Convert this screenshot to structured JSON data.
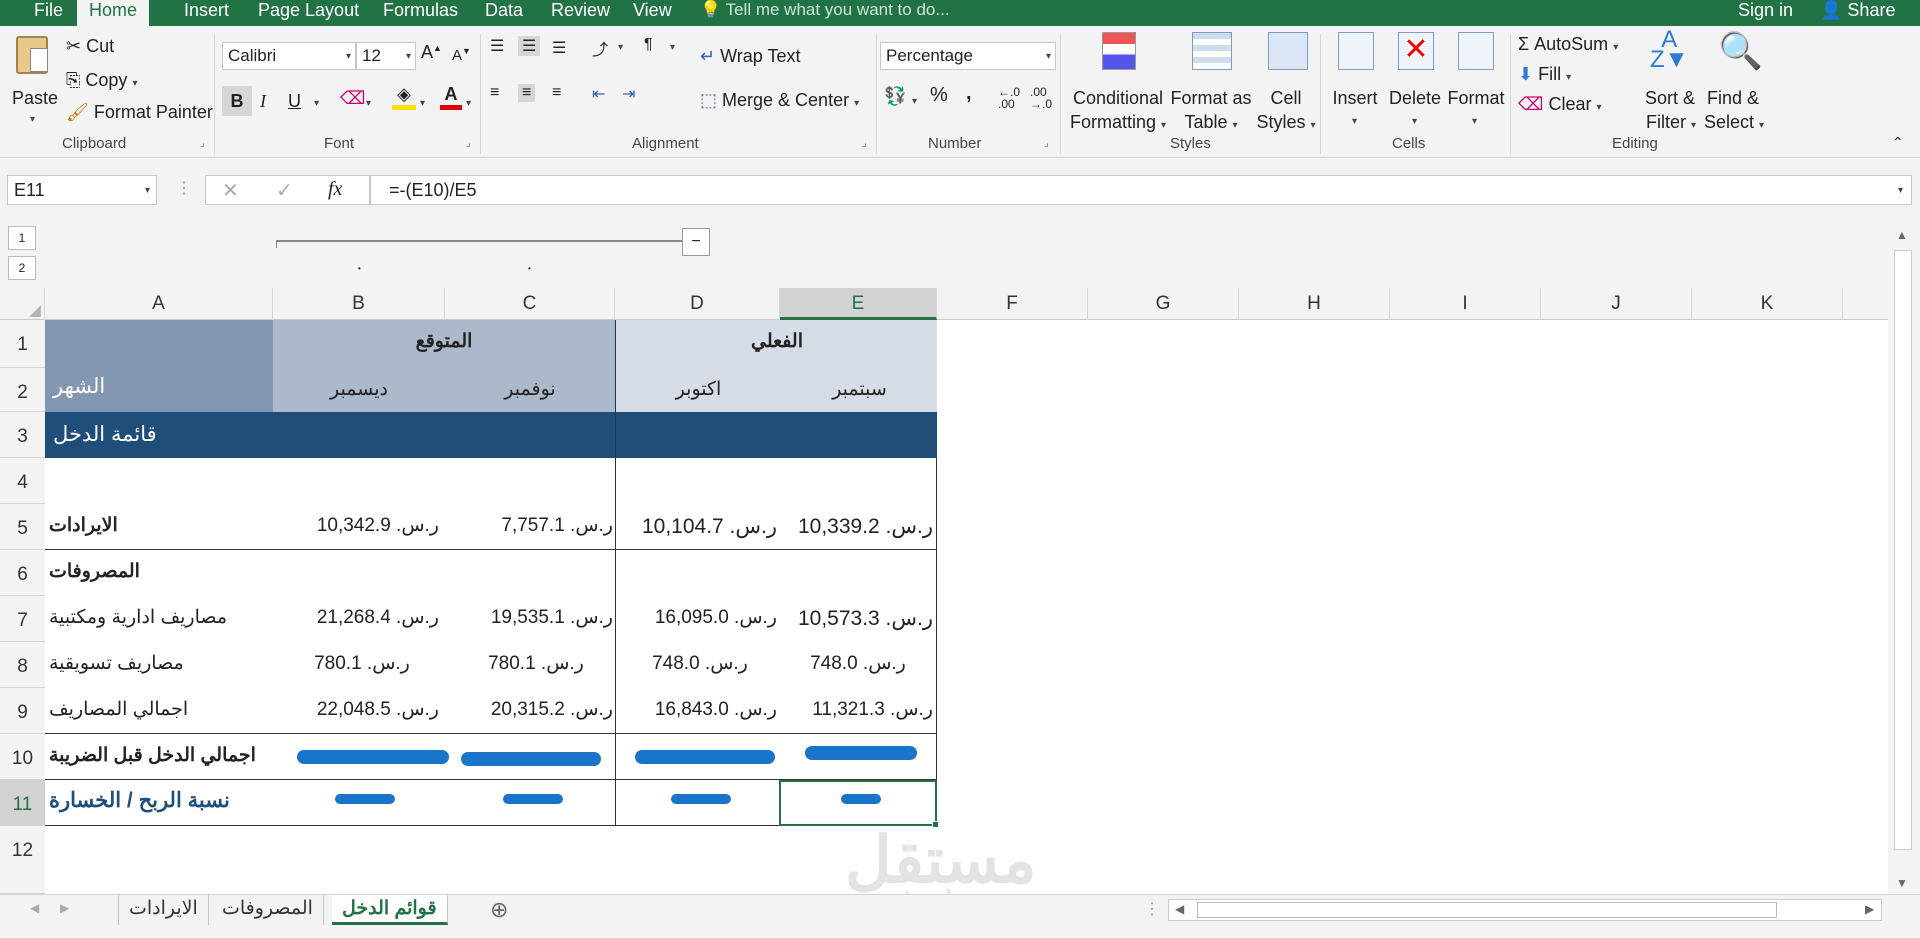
{
  "menu": {
    "items": [
      "File",
      "Home",
      "Insert",
      "Page Layout",
      "Formulas",
      "Data",
      "Review",
      "View"
    ],
    "active": "Home",
    "tell_me": "Tell me what you want to do...",
    "sign_in": "Sign in",
    "share": "Share"
  },
  "ribbon": {
    "clipboard": {
      "paste": "Paste",
      "cut": "Cut",
      "copy": "Copy",
      "format_painter": "Format Painter",
      "label": "Clipboard"
    },
    "font": {
      "family": "Calibri",
      "size": "12",
      "bold": "B",
      "italic": "I",
      "underline": "U",
      "label": "Font"
    },
    "alignment": {
      "wrap": "Wrap Text",
      "merge": "Merge & Center",
      "label": "Alignment"
    },
    "number": {
      "format": "Percentage",
      "percent": "%",
      "comma": ",",
      "label": "Number"
    },
    "styles": {
      "conditional": "Conditional",
      "conditional2": "Formatting",
      "format_table": "Format as",
      "format_table2": "Table",
      "cell_styles": "Cell",
      "cell_styles2": "Styles",
      "label": "Styles"
    },
    "cells": {
      "insert": "Insert",
      "delete": "Delete",
      "format": "Format",
      "label": "Cells"
    },
    "editing": {
      "autosum": "AutoSum",
      "fill": "Fill",
      "clear": "Clear",
      "sort": "Sort &",
      "sort2": "Filter",
      "find": "Find &",
      "find2": "Select",
      "label": "Editing"
    }
  },
  "formula_bar": {
    "name_box": "E11",
    "fx": "fx",
    "formula": "=-(E10)/E5"
  },
  "outline": {
    "levels": [
      "1",
      "2"
    ],
    "collapse": "−"
  },
  "columns": [
    "A",
    "B",
    "C",
    "D",
    "E",
    "F",
    "G",
    "H",
    "I",
    "J",
    "K"
  ],
  "rows": [
    "1",
    "2",
    "3",
    "4",
    "5",
    "6",
    "7",
    "8",
    "9",
    "10",
    "11",
    "12"
  ],
  "sheet": {
    "hdr_forecast": "المتوقع",
    "hdr_actual": "الفعلي",
    "hdr_month": "الشهر",
    "m_dec": "ديسمبر",
    "m_nov": "نوفمبر",
    "m_oct": "اكتوبر",
    "m_sep": "سبتمبر",
    "section": "قائمة الدخل",
    "r5_label": "الايرادات",
    "r5": [
      "ر.س. 10,342.9",
      "ر.س. 7,757.1",
      "ر.س. 10,104.7",
      "ر.س. 10,339.2"
    ],
    "r6_label": "المصروفات",
    "r7_label": "مصاريف ادارية ومكتبية",
    "r7": [
      "ر.س. 21,268.4",
      "ر.س. 19,535.1",
      "ر.س. 16,095.0",
      "ر.س. 10,573.3"
    ],
    "r8_label": "مصاريف تسويقية",
    "r8": [
      "ر.س. 780.1",
      "ر.س. 780.1",
      "ر.س. 748.0",
      "ر.س. 748.0"
    ],
    "r9_label": "اجمالي المصاريف",
    "r9": [
      "ر.س. 22,048.5",
      "ر.س. 20,315.2",
      "ر.س. 16,843.0",
      "ر.س. 11,321.3"
    ],
    "r10_label": "اجمالي الدخل قبل الضريبة",
    "r11_label": "نسبة الربح / الخسارة"
  },
  "tabs": [
    "الايرادات",
    "المصروفات",
    "قوائم الدخل"
  ],
  "active_tab": "قوائم الدخل",
  "watermark": "mostaql.com",
  "colors": {
    "excel_green": "#217346",
    "header_dark": "#1f4e79",
    "header_mid": "#8497b0",
    "header_light": "#acb9ca",
    "negative": "#e00000",
    "scribble": "#1a74c9"
  }
}
